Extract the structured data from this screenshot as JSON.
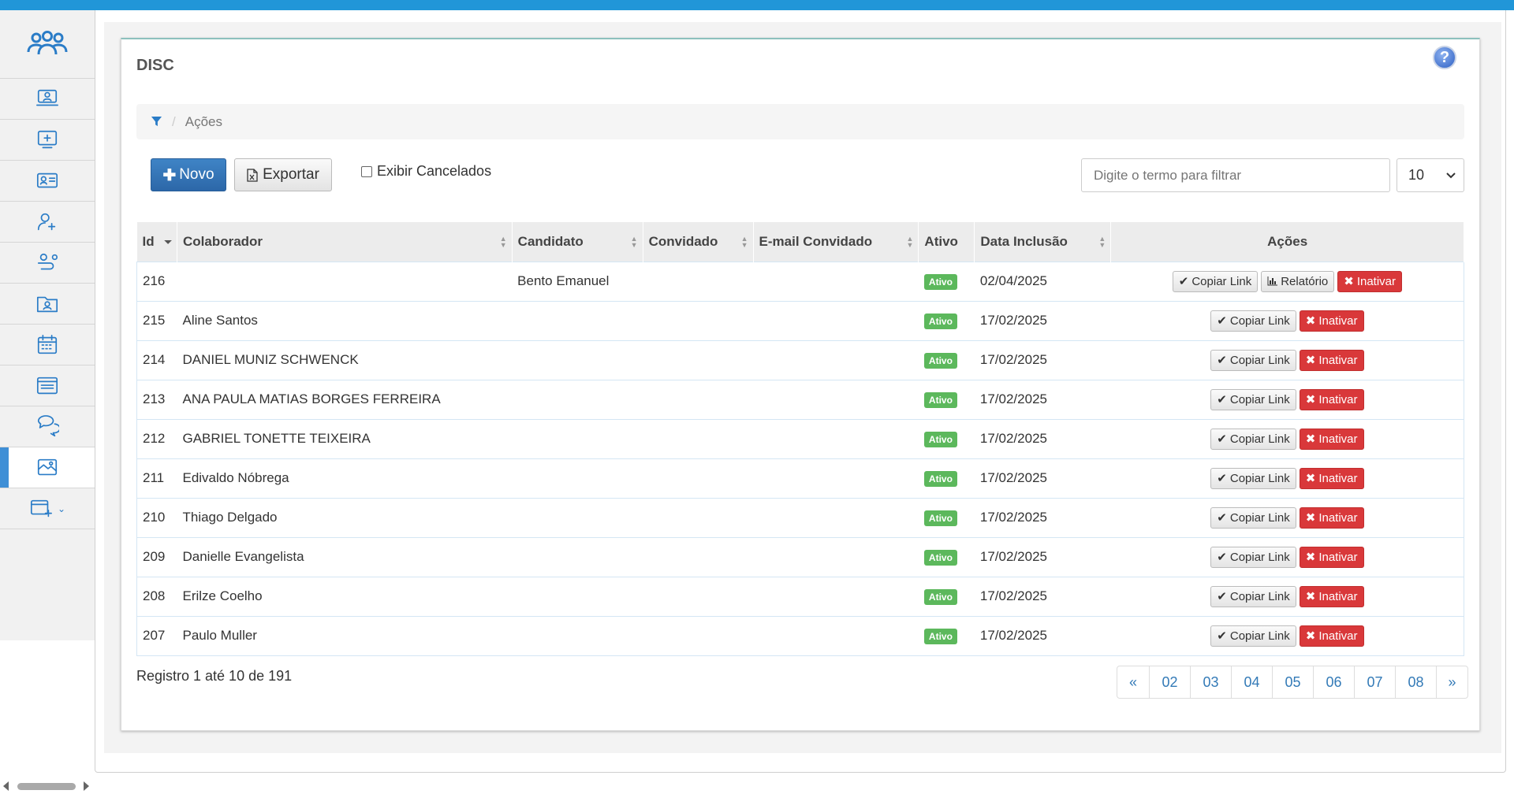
{
  "sidebar": {
    "logo_icon": "users-group-icon",
    "items": [
      {
        "icon": "monitor-user-icon"
      },
      {
        "icon": "screen-plus-icon"
      },
      {
        "icon": "id-card-icon"
      },
      {
        "icon": "user-add-icon"
      },
      {
        "icon": "user-route-icon"
      },
      {
        "icon": "folder-user-icon"
      },
      {
        "icon": "calendar-icon"
      },
      {
        "icon": "list-board-icon"
      },
      {
        "icon": "chat-bubbles-icon"
      },
      {
        "icon": "puzzle-image-icon",
        "active": true
      },
      {
        "icon": "window-add-icon",
        "caret": "⌄"
      }
    ]
  },
  "page": {
    "title": "DISC",
    "help": "?"
  },
  "breadcrumb": {
    "sep": "/",
    "current": "Ações"
  },
  "toolbar": {
    "novo_label": "Novo",
    "exportar_label": "Exportar",
    "exibir_cancelados_label": "Exibir Cancelados",
    "filter_placeholder": "Digite o termo para filtrar",
    "page_size": "10"
  },
  "table": {
    "headers": {
      "id": "Id",
      "colaborador": "Colaborador",
      "candidato": "Candidato",
      "convidado": "Convidado",
      "email_convidado": "E-mail Convidado",
      "ativo": "Ativo",
      "data_inclusao": "Data Inclusão",
      "acoes": "Ações"
    },
    "labels": {
      "ativo": "Ativo",
      "copiar_link": "Copiar Link",
      "relatorio": "Relatório",
      "inativar": "Inativar"
    },
    "rows": [
      {
        "id": "216",
        "colaborador": "",
        "candidato": "Bento Emanuel",
        "convidado": "",
        "email": "",
        "ativo": "Ativo",
        "data": "02/04/2025",
        "relatorio": true
      },
      {
        "id": "215",
        "colaborador": "Aline Santos",
        "candidato": "",
        "convidado": "",
        "email": "",
        "ativo": "Ativo",
        "data": "17/02/2025",
        "relatorio": false
      },
      {
        "id": "214",
        "colaborador": "DANIEL MUNIZ SCHWENCK",
        "candidato": "",
        "convidado": "",
        "email": "",
        "ativo": "Ativo",
        "data": "17/02/2025",
        "relatorio": false
      },
      {
        "id": "213",
        "colaborador": "ANA PAULA MATIAS BORGES FERREIRA",
        "candidato": "",
        "convidado": "",
        "email": "",
        "ativo": "Ativo",
        "data": "17/02/2025",
        "relatorio": false
      },
      {
        "id": "212",
        "colaborador": "GABRIEL TONETTE TEIXEIRA",
        "candidato": "",
        "convidado": "",
        "email": "",
        "ativo": "Ativo",
        "data": "17/02/2025",
        "relatorio": false
      },
      {
        "id": "211",
        "colaborador": "Edivaldo Nóbrega",
        "candidato": "",
        "convidado": "",
        "email": "",
        "ativo": "Ativo",
        "data": "17/02/2025",
        "relatorio": false
      },
      {
        "id": "210",
        "colaborador": "Thiago Delgado",
        "candidato": "",
        "convidado": "",
        "email": "",
        "ativo": "Ativo",
        "data": "17/02/2025",
        "relatorio": false
      },
      {
        "id": "209",
        "colaborador": "Danielle Evangelista",
        "candidato": "",
        "convidado": "",
        "email": "",
        "ativo": "Ativo",
        "data": "17/02/2025",
        "relatorio": false
      },
      {
        "id": "208",
        "colaborador": "Erilze Coelho",
        "candidato": "",
        "convidado": "",
        "email": "",
        "ativo": "Ativo",
        "data": "17/02/2025",
        "relatorio": false
      },
      {
        "id": "207",
        "colaborador": "Paulo Muller",
        "candidato": "",
        "convidado": "",
        "email": "",
        "ativo": "Ativo",
        "data": "17/02/2025",
        "relatorio": false
      }
    ]
  },
  "footer": {
    "info": "Registro 1 até 10 de 191",
    "pages": [
      "«",
      "02",
      "03",
      "04",
      "05",
      "06",
      "07",
      "08",
      "»"
    ]
  },
  "colors": {
    "topbar": "#2196d8",
    "primary": "#2c67a8",
    "success": "#5cb85c",
    "danger": "#d9383a",
    "link": "#337ab7"
  }
}
